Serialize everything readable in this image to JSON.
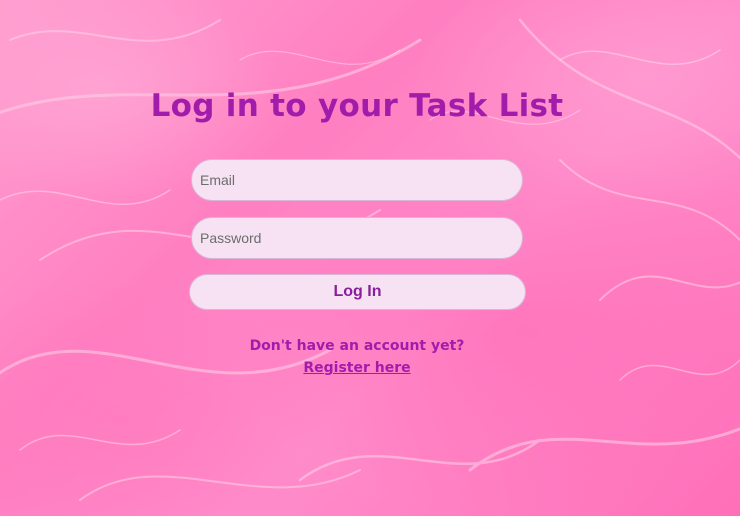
{
  "page": {
    "title": "Log in to your Task List"
  },
  "form": {
    "email_placeholder": "Email",
    "email_value": "",
    "password_placeholder": "Password",
    "password_value": "",
    "login_label": "Log In"
  },
  "footer": {
    "no_account_text": "Don't have an account yet?",
    "register_link": "Register here"
  },
  "colors": {
    "accent": "#a21cab",
    "field_bg": "#f6e2f3",
    "background": "#ff8ccb"
  }
}
